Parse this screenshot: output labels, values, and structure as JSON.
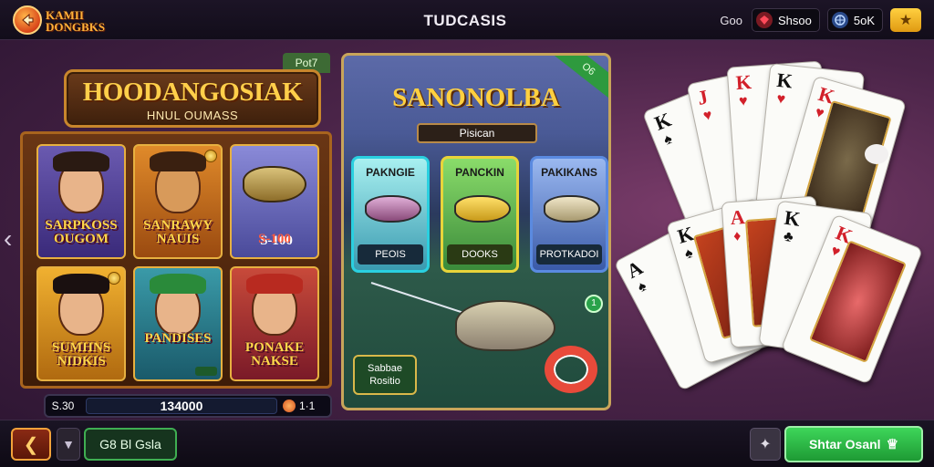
{
  "header": {
    "logo_text": "KAMII DONGBKS",
    "title": "TUDCASIS",
    "label": "Goo",
    "pill1": "Shsoo",
    "pill2": "5oK",
    "star_icon": "star-icon"
  },
  "slot": {
    "tag": "Pot7",
    "title": "HOODANGOSIAK",
    "subtitle": "HNUL OUMASS",
    "cells": [
      {
        "label": "SARPKOSS OUGOM"
      },
      {
        "label": "SANRAWY NAUIS"
      },
      {
        "label": "S-100"
      },
      {
        "label": "SUMHNS NIDKIS"
      },
      {
        "label": "PANDISES"
      },
      {
        "label": "PONAKE NAKSE"
      }
    ],
    "bar_left": "S.30",
    "bar_value": "134000",
    "bar_right": "1·1"
  },
  "fishing": {
    "ribbon": "O6",
    "title": "SANONOLBA",
    "subbar": "Pisican",
    "cards": [
      {
        "name": "PAKNGIE",
        "foot": "PEOIS"
      },
      {
        "name": "PANCKIN",
        "foot": "DOOKS"
      },
      {
        "name": "PAKIKANS",
        "foot": "PROTKADOI"
      }
    ],
    "promo": "Sabbae Rositio",
    "badge": "1"
  },
  "bottom": {
    "gold_button": "G8 Bl Gsla",
    "start_button": "Shtar Osanl"
  },
  "colors": {
    "accent_gold": "#ffcf4a",
    "start_green": "#3ed65a",
    "background": "#4a2448"
  }
}
